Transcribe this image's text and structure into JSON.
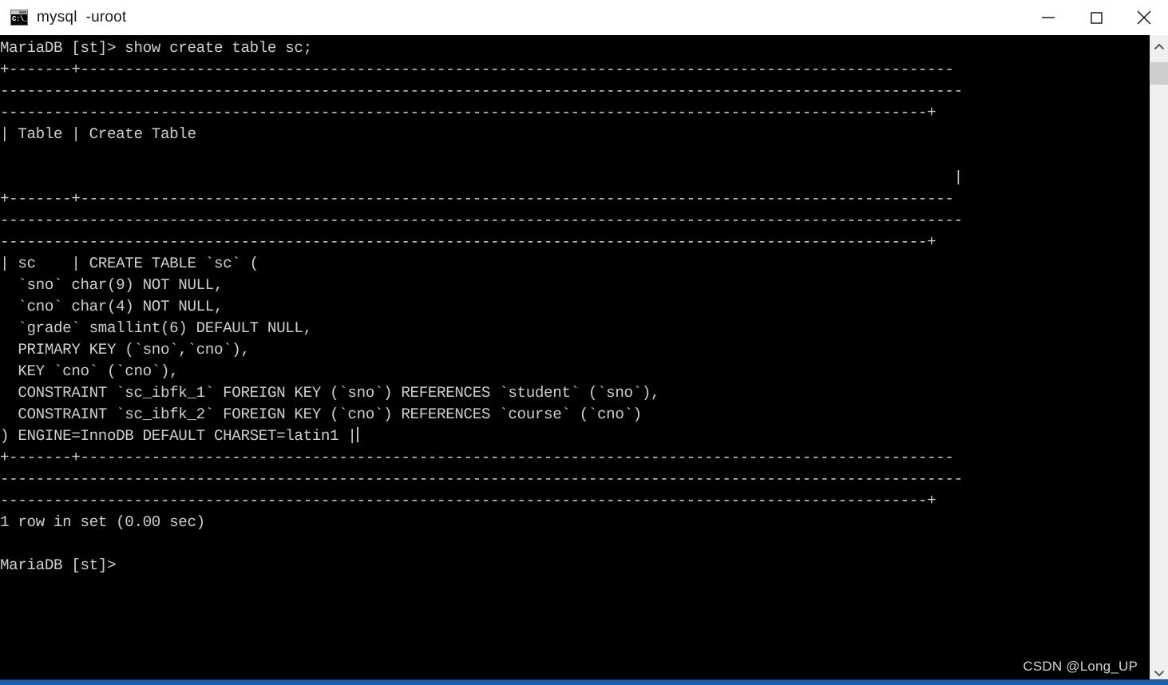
{
  "window": {
    "title": "mysql  -uroot",
    "icon": "console-icon",
    "controls": {
      "minimize_label": "Minimize",
      "maximize_label": "Maximize",
      "close_label": "Close"
    }
  },
  "terminal": {
    "background_color": "#000000",
    "text_color": "#cfcfcf",
    "prompt": "MariaDB [st]>",
    "command": "show create table sc;",
    "lines": [
      "MariaDB [st]> show create table sc;",
      "+-------+--------------------------------------------------------------------------------------------------",
      "------------------------------------------------------------------------------------------------------------",
      "--------------------------------------------------------------------------------------------------------+",
      "| Table | Create Table",
      "",
      "                                                                                                           |",
      "+-------+--------------------------------------------------------------------------------------------------",
      "------------------------------------------------------------------------------------------------------------",
      "--------------------------------------------------------------------------------------------------------+",
      "| sc    | CREATE TABLE `sc` (",
      "  `sno` char(9) NOT NULL,",
      "  `cno` char(4) NOT NULL,",
      "  `grade` smallint(6) DEFAULT NULL,",
      "  PRIMARY KEY (`sno`,`cno`),",
      "  KEY `cno` (`cno`),",
      "  CONSTRAINT `sc_ibfk_1` FOREIGN KEY (`sno`) REFERENCES `student` (`sno`),",
      "  CONSTRAINT `sc_ibfk_2` FOREIGN KEY (`cno`) REFERENCES `course` (`cno`)",
      ") ENGINE=InnoDB DEFAULT CHARSET=latin1 |",
      "+-------+--------------------------------------------------------------------------------------------------",
      "------------------------------------------------------------------------------------------------------------",
      "--------------------------------------------------------------------------------------------------------+",
      "1 row in set (0.00 sec)",
      "",
      "MariaDB [st]>"
    ],
    "result_status": "1 row in set (0.00 sec)",
    "table_headers": [
      "Table",
      "Create Table"
    ],
    "table_row": [
      "sc",
      "CREATE TABLE `sc` ("
    ]
  },
  "watermark": {
    "text": "CSDN @Long_UP"
  },
  "scrollbar": {
    "up_arrow": "chevron-up-icon",
    "down_arrow": "chevron-down-icon",
    "thumb_position_percent": 4
  },
  "colors": {
    "accent": "#1861ae",
    "terminal_bg": "#000000",
    "terminal_fg": "#cfcfcf",
    "titlebar_bg": "#ffffff"
  }
}
